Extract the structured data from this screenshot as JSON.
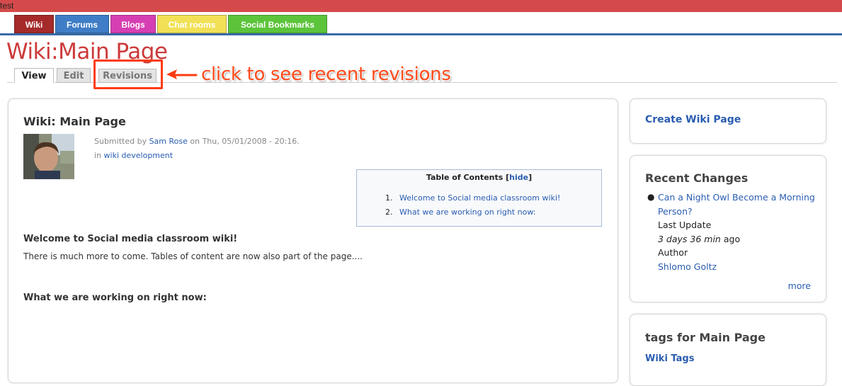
{
  "site": {
    "name": "test"
  },
  "nav": {
    "tabs": [
      {
        "label": "Wiki",
        "color": "#a52a2a"
      },
      {
        "label": "Forums",
        "color": "#3f7dc6"
      },
      {
        "label": "Blogs",
        "color": "#d63fb3"
      },
      {
        "label": "Chat rooms",
        "color": "#f2e156"
      },
      {
        "label": "Social Bookmarks",
        "color": "#5cc43a"
      }
    ]
  },
  "page": {
    "heading": "Wiki:Main Page",
    "local_tabs": [
      "View",
      "Edit",
      "Revisions"
    ],
    "annotation": "click to see recent revisions"
  },
  "node": {
    "title": "Wiki: Main Page",
    "submitted_prefix": "Submitted by",
    "author": "Sam Rose",
    "date_text": "on Thu, 05/01/2008 - 20:16.",
    "in_prefix": "in",
    "category": "wiki development",
    "toc": {
      "title": "Table of Contents",
      "hide_label": "hide",
      "items": [
        {
          "num": "1.",
          "text": "Welcome to Social media classroom wiki!"
        },
        {
          "num": "2.",
          "text": "What we are working on right now:"
        }
      ]
    },
    "section1_heading": "Welcome to Social media classroom wiki!",
    "section1_text": "There is much more to come. Tables of content are now also part of the page....",
    "section2_heading": "What we are working on right now:"
  },
  "sidebar": {
    "create_link": "Create Wiki Page",
    "recent_changes": {
      "title": "Recent Changes",
      "item_title": "Can a Night Owl Become a Morning Person?",
      "last_update_label": "Last Update",
      "last_update_time": "3 days 36 min",
      "last_update_suffix": "ago",
      "author_label": "Author",
      "author_name": "Shlomo Goltz",
      "more": "more"
    },
    "tags": {
      "title": "tags for Main Page",
      "link": "Wiki Tags"
    }
  },
  "colors": {
    "top_bar": "#d44a4a",
    "nav_rule": "#3a6aa8",
    "heading": "#cc3a3a",
    "link": "#2a5db0",
    "annotation": "#ff4a1a"
  }
}
